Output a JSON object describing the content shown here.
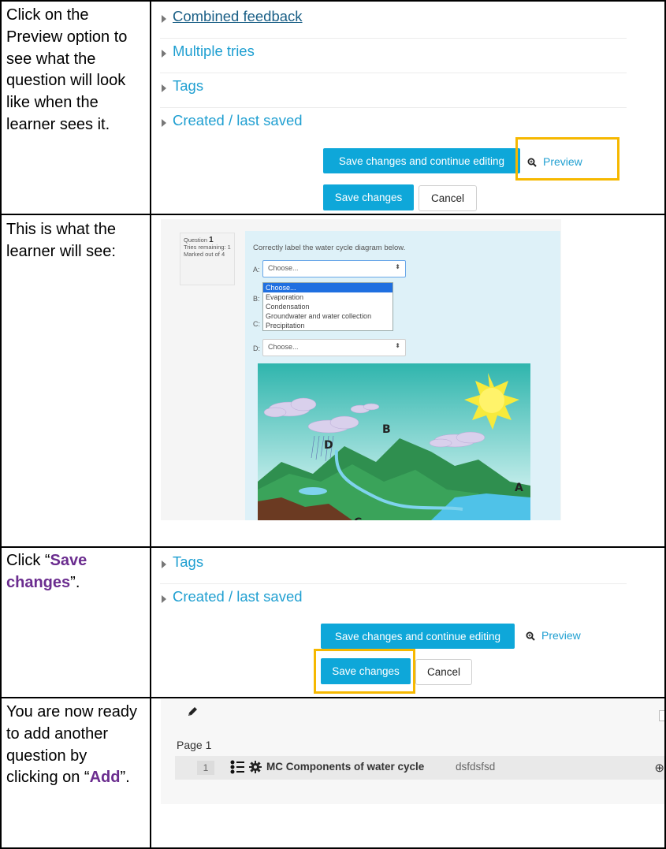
{
  "rows": [
    {
      "instruction": "Click on the Preview option to see what the question will look like when the learner sees it.",
      "collapsibles": [
        "Combined feedback",
        "Multiple tries",
        "Tags",
        "Created / last saved"
      ],
      "save_continue_label": "Save changes and continue editing",
      "preview_label": "Preview",
      "save_label": "Save changes",
      "cancel_label": "Cancel",
      "highlight_target": "Preview"
    },
    {
      "instruction": "This is what the learner will see:",
      "question_label": "Question",
      "question_number": "1",
      "tries_remaining": "Tries remaining: 1",
      "marked_out_of": "Marked out of 4",
      "prompt": "Correctly label the water cycle diagram below.",
      "fields": [
        {
          "letter": "A:",
          "value": "Choose..."
        },
        {
          "letter": "B:",
          "value": ""
        },
        {
          "letter": "C:",
          "value": ""
        },
        {
          "letter": "D:",
          "value": "Choose..."
        }
      ],
      "dropdown_options": [
        "Choose...",
        "Evaporation",
        "Condensation",
        "Groundwater and water collection",
        "Precipitation"
      ],
      "diagram_labels": [
        "A",
        "B",
        "C",
        "D"
      ]
    },
    {
      "instruction_prefix": "Click “",
      "instruction_emph": "Save changes",
      "instruction_suffix": "”.",
      "collapsibles": [
        "Tags",
        "Created / last saved"
      ],
      "save_continue_label": "Save changes and continue editing",
      "preview_label": "Preview",
      "save_label": "Save changes",
      "cancel_label": "Cancel",
      "highlight_target": "Save changes"
    },
    {
      "instruction_prefix": "You are now ready to add another question by clicking on “",
      "instruction_emph": "Add",
      "instruction_suffix": "”.",
      "page_label": "Page 1",
      "slot_number": "1",
      "question_title": "MC Components of water cycle",
      "question_text": "dsfdsfsd"
    }
  ],
  "colors": {
    "link": "#1f9fd1",
    "primary_button": "#0ea7d9",
    "highlight": "#f6b800",
    "emphasis": "#6b2d8f"
  }
}
